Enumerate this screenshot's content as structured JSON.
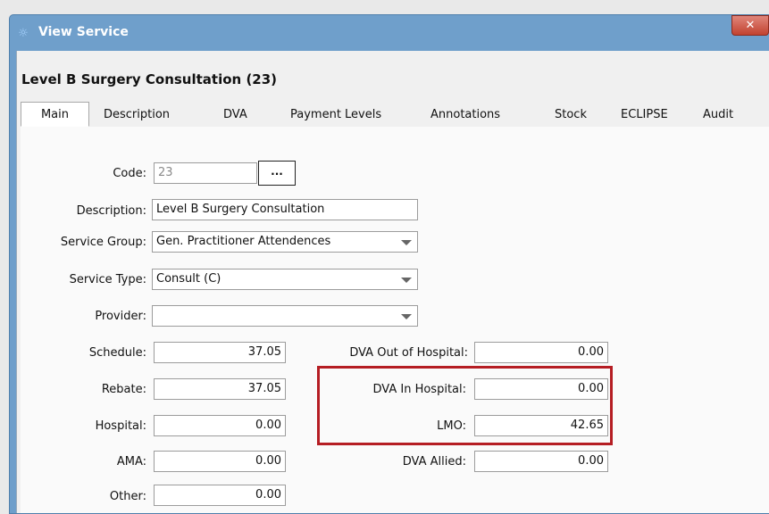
{
  "window": {
    "title": "View Service",
    "close_label": "✕"
  },
  "header": {
    "service_title": "Level B Surgery Consultation (23)"
  },
  "tabs": [
    {
      "label": "Main"
    },
    {
      "label": "Description"
    },
    {
      "label": "DVA"
    },
    {
      "label": "Payment Levels"
    },
    {
      "label": "Annotations"
    },
    {
      "label": "Stock"
    },
    {
      "label": "ECLIPSE"
    },
    {
      "label": "Audit"
    }
  ],
  "active_tab": "Main",
  "form": {
    "code": {
      "label": "Code:",
      "value": "23",
      "button": "..."
    },
    "description": {
      "label": "Description:",
      "value": "Level B Surgery Consultation"
    },
    "service_group": {
      "label": "Service Group:",
      "value": "Gen. Practitioner Attendences"
    },
    "service_type": {
      "label": "Service Type:",
      "value": "Consult (C)"
    },
    "provider": {
      "label": "Provider:",
      "value": ""
    },
    "schedule": {
      "label": "Schedule:",
      "value": "37.05"
    },
    "rebate": {
      "label": "Rebate:",
      "value": "37.05"
    },
    "hospital": {
      "label": "Hospital:",
      "value": "0.00"
    },
    "ama": {
      "label": "AMA:",
      "value": "0.00"
    },
    "other": {
      "label": "Other:",
      "value": "0.00"
    },
    "dva_out": {
      "label": "DVA Out of Hospital:",
      "value": "0.00"
    },
    "dva_in": {
      "label": "DVA In Hospital:",
      "value": "0.00"
    },
    "lmo": {
      "label": "LMO:",
      "value": "42.65"
    },
    "dva_allied": {
      "label": "DVA Allied:",
      "value": "0.00"
    }
  },
  "colors": {
    "title_bar": "#6f9fcb",
    "highlight_box": "#b51d23",
    "close_button": "#c2422f"
  }
}
